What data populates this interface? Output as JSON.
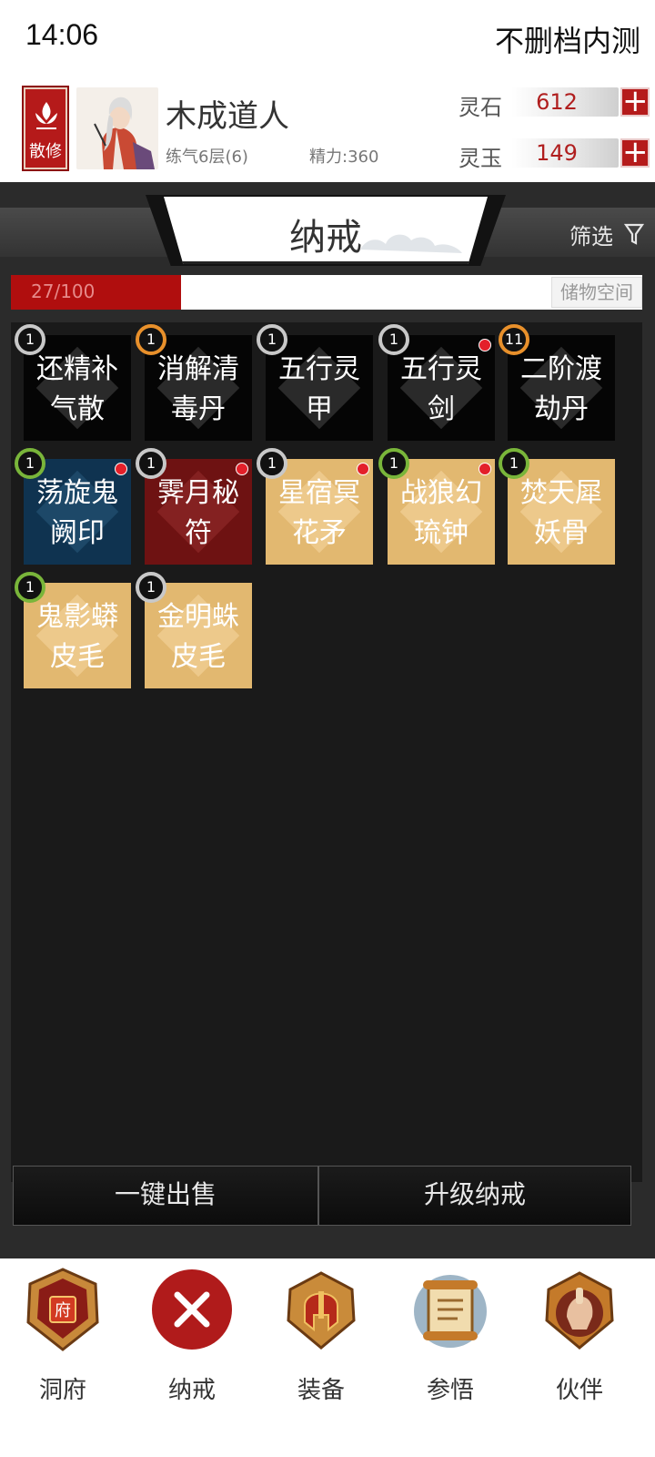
{
  "status_bar": {
    "time": "14:06",
    "title": "不删档内测"
  },
  "player": {
    "sect_label": "散修",
    "name": "木成道人",
    "realm": "练气6层(6)",
    "energy": "精力:360"
  },
  "currencies": [
    {
      "label": "灵石",
      "value": "612",
      "add_label": "+"
    },
    {
      "label": "灵玉",
      "value": "149",
      "add_label": "+"
    }
  ],
  "page": {
    "title": "纳戒",
    "filter_label": "筛选"
  },
  "capacity": {
    "text": "27/100",
    "used": 27,
    "total": 100,
    "label": "储物空间"
  },
  "items": [
    {
      "line1": "还精补",
      "line2": "气散",
      "qty": "1",
      "ring": "gray",
      "bg": "black",
      "new": false
    },
    {
      "line1": "消解清",
      "line2": "毒丹",
      "qty": "1",
      "ring": "orange",
      "bg": "black",
      "new": false
    },
    {
      "line1": "五行灵",
      "line2": "甲",
      "qty": "1",
      "ring": "gray",
      "bg": "black",
      "new": false
    },
    {
      "line1": "五行灵",
      "line2": "剑",
      "qty": "1",
      "ring": "gray",
      "bg": "black",
      "new": true
    },
    {
      "line1": "二阶渡",
      "line2": "劫丹",
      "qty": "11",
      "ring": "orange",
      "bg": "black",
      "new": false
    },
    {
      "line1": "荡旋鬼",
      "line2": "阙印",
      "qty": "1",
      "ring": "green",
      "bg": "blue",
      "new": true
    },
    {
      "line1": "霁月秘",
      "line2": "符",
      "qty": "1",
      "ring": "gray",
      "bg": "red",
      "new": true
    },
    {
      "line1": "星宿冥",
      "line2": "花矛",
      "qty": "1",
      "ring": "gray",
      "bg": "gold",
      "new": true
    },
    {
      "line1": "战狼幻",
      "line2": "琉钟",
      "qty": "1",
      "ring": "green",
      "bg": "gold",
      "new": true
    },
    {
      "line1": "焚天犀",
      "line2": "妖骨",
      "qty": "1",
      "ring": "green",
      "bg": "gold",
      "new": false
    },
    {
      "line1": "鬼影蟒",
      "line2": "皮毛",
      "qty": "1",
      "ring": "green",
      "bg": "gold",
      "new": false
    },
    {
      "line1": "金明蛛",
      "line2": "皮毛",
      "qty": "1",
      "ring": "gray",
      "bg": "gold",
      "new": false
    }
  ],
  "actions": {
    "sell_all": "一键出售",
    "upgrade": "升级纳戒"
  },
  "nav": [
    {
      "label": "洞府",
      "icon": "cave-mansion-icon",
      "badge_char": "府"
    },
    {
      "label": "纳戒",
      "icon": "close-icon"
    },
    {
      "label": "装备",
      "icon": "helmet-icon"
    },
    {
      "label": "参悟",
      "icon": "scroll-icon"
    },
    {
      "label": "伙伴",
      "icon": "companion-icon"
    }
  ],
  "colors": {
    "accent_red": "#b51b1b",
    "panel_dark": "#2b2b2b",
    "ring_green": "#79b53a",
    "ring_orange": "#e8902b"
  }
}
